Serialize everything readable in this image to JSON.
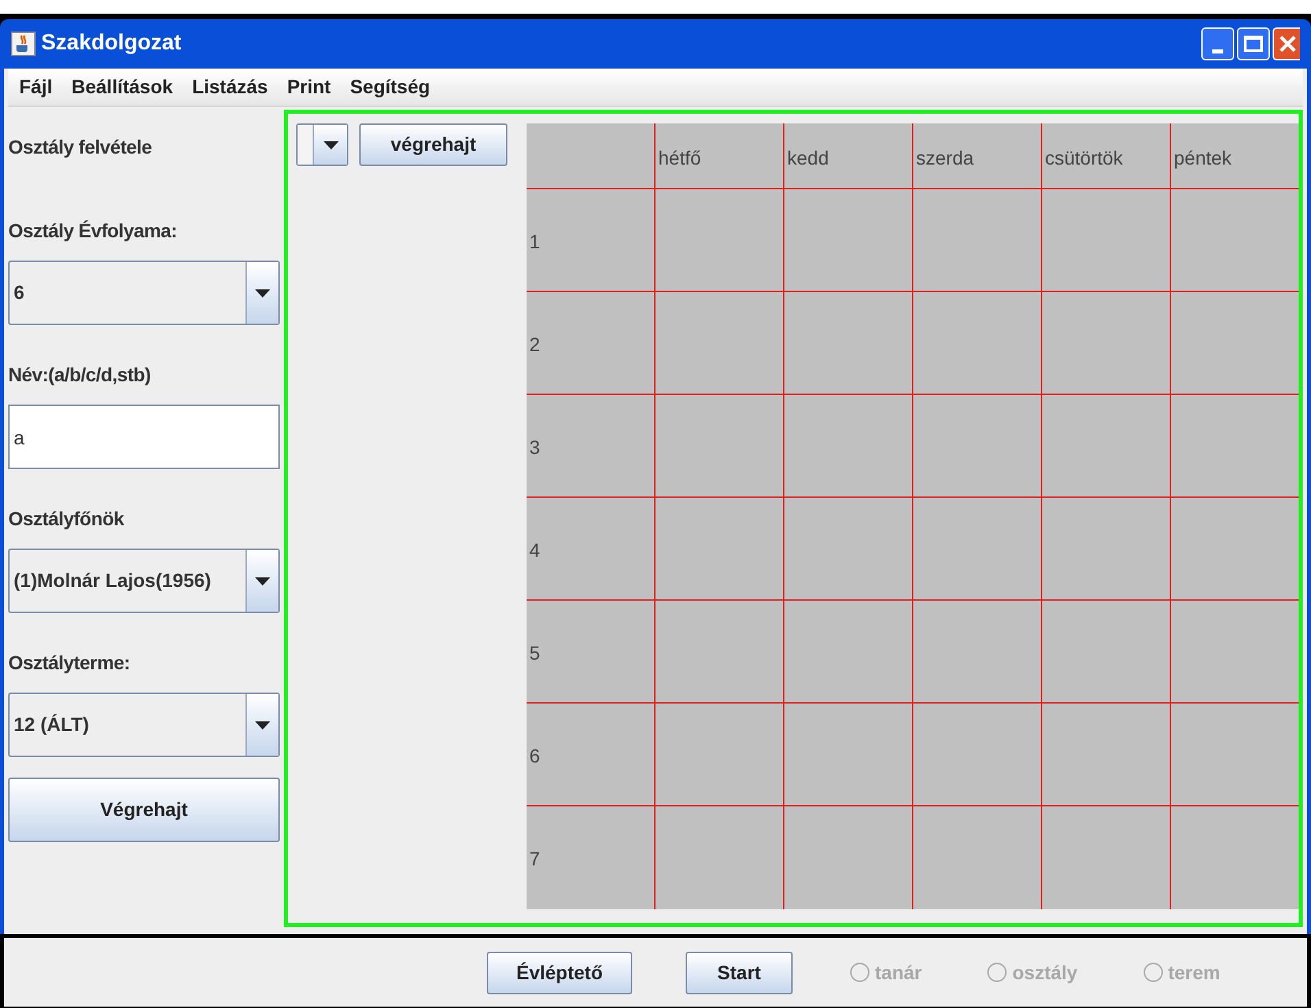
{
  "window": {
    "title": "Szakdolgozat"
  },
  "menu": [
    "Fájl",
    "Beállítások",
    "Listázás",
    "Print",
    "Segítség"
  ],
  "form": [
    {
      "kind": "label",
      "text": "Osztály felvétele"
    },
    {
      "kind": "label",
      "text": "Osztály Évfolyama:"
    },
    {
      "kind": "combo",
      "value": "6"
    },
    {
      "kind": "label",
      "text": "Név:(a/b/c/d,stb)"
    },
    {
      "kind": "input",
      "value": "a"
    },
    {
      "kind": "label",
      "text": "Osztályfőnök"
    },
    {
      "kind": "combo",
      "value": "(1)Molnár Lajos(1956)"
    },
    {
      "kind": "label",
      "text": "Osztályterme:"
    },
    {
      "kind": "combo",
      "value": "12 (ÁLT)"
    },
    {
      "kind": "button",
      "text": "Végrehajt"
    }
  ],
  "toolbar": {
    "button": "végrehajt"
  },
  "table": {
    "columns": [
      "hétfő",
      "kedd",
      "szerda",
      "csütörtök",
      "péntek"
    ],
    "rows": [
      "1",
      "2",
      "3",
      "4",
      "5",
      "6",
      "7"
    ]
  },
  "bottom": {
    "buttons": [
      "Évléptető",
      "Start"
    ],
    "radios": [
      {
        "label": "tanár",
        "selected": false,
        "disabled": true
      },
      {
        "label": "osztály",
        "selected": false,
        "disabled": true
      },
      {
        "label": "terem",
        "selected": false,
        "disabled": true
      }
    ]
  }
}
